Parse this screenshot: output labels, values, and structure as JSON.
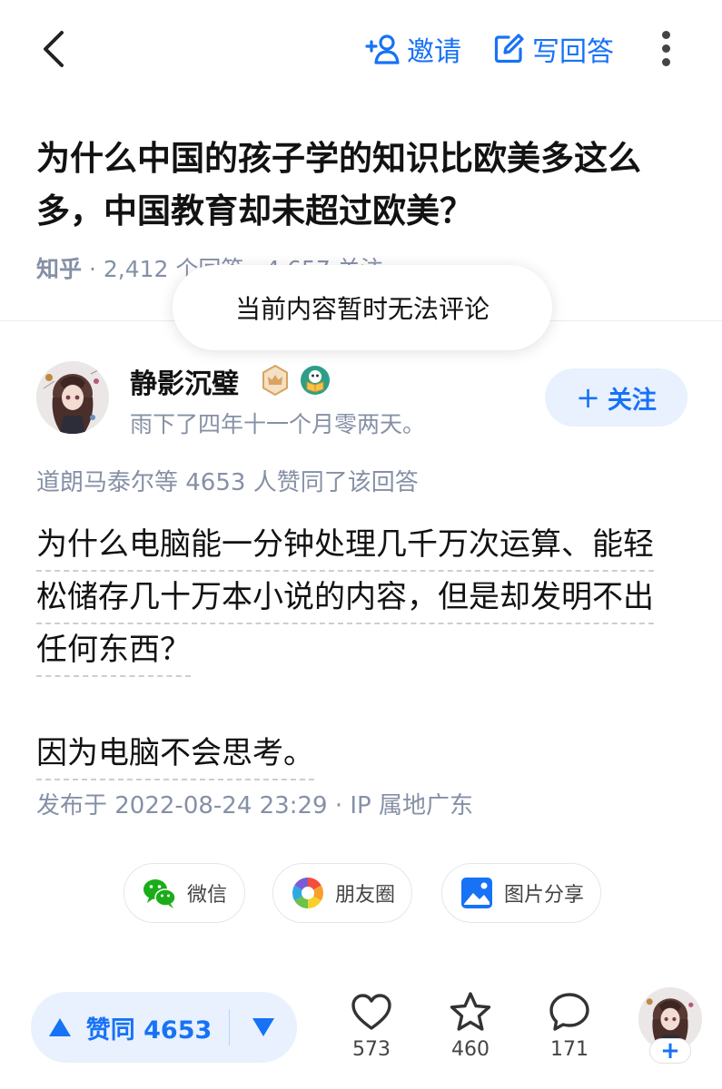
{
  "header": {
    "invite_label": "邀请",
    "write_label": "写回答"
  },
  "question": {
    "title": "为什么中国的孩子学的知识比欧美多这么多，中国教育却未超过欧美？",
    "source": "知乎",
    "meta": " · 2,412 个回答 · 4,657 关注 ›"
  },
  "toast": {
    "message": "当前内容暂时无法评论"
  },
  "author": {
    "name": "静影沉璧",
    "bio": "雨下了四年十一个月零两天。",
    "follow_label": "关注"
  },
  "answer": {
    "voters_text": "道朗马泰尔等 4653 人赞同了该回答",
    "lines": [
      "为什么电脑能一分钟处理几千万次运算、能轻",
      "松储存几十万本小说的内容，但是却发明不出",
      "任何东西？",
      "因为电脑不会思考。"
    ],
    "published": "发布于 2022-08-24 23:29 · IP 属地广东"
  },
  "share": {
    "wechat": "微信",
    "moments": "朋友圈",
    "image": "图片分享"
  },
  "bottom_bar": {
    "vote_label": "赞同 4653",
    "like_count": "573",
    "favorite_count": "460",
    "comment_count": "171",
    "plus_label": "+"
  },
  "colors": {
    "accent": "#1772f6",
    "muted": "#8590a6",
    "text": "#121212"
  }
}
